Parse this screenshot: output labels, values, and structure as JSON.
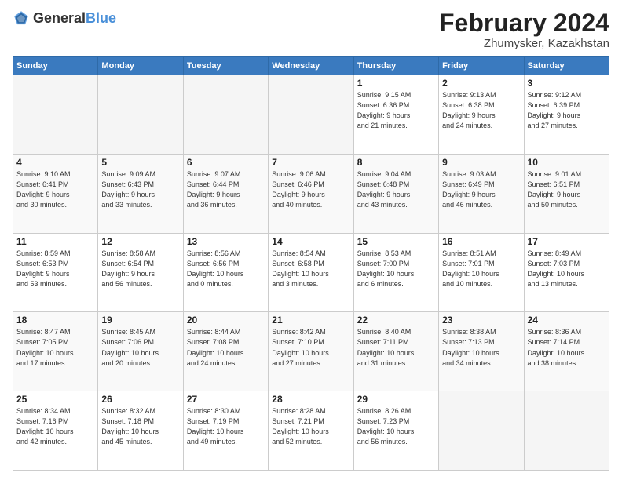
{
  "header": {
    "logo_general": "General",
    "logo_blue": "Blue",
    "title": "February 2024",
    "location": "Zhumysker, Kazakhstan"
  },
  "weekdays": [
    "Sunday",
    "Monday",
    "Tuesday",
    "Wednesday",
    "Thursday",
    "Friday",
    "Saturday"
  ],
  "weeks": [
    [
      {
        "day": "",
        "info": ""
      },
      {
        "day": "",
        "info": ""
      },
      {
        "day": "",
        "info": ""
      },
      {
        "day": "",
        "info": ""
      },
      {
        "day": "1",
        "info": "Sunrise: 9:15 AM\nSunset: 6:36 PM\nDaylight: 9 hours\nand 21 minutes."
      },
      {
        "day": "2",
        "info": "Sunrise: 9:13 AM\nSunset: 6:38 PM\nDaylight: 9 hours\nand 24 minutes."
      },
      {
        "day": "3",
        "info": "Sunrise: 9:12 AM\nSunset: 6:39 PM\nDaylight: 9 hours\nand 27 minutes."
      }
    ],
    [
      {
        "day": "4",
        "info": "Sunrise: 9:10 AM\nSunset: 6:41 PM\nDaylight: 9 hours\nand 30 minutes."
      },
      {
        "day": "5",
        "info": "Sunrise: 9:09 AM\nSunset: 6:43 PM\nDaylight: 9 hours\nand 33 minutes."
      },
      {
        "day": "6",
        "info": "Sunrise: 9:07 AM\nSunset: 6:44 PM\nDaylight: 9 hours\nand 36 minutes."
      },
      {
        "day": "7",
        "info": "Sunrise: 9:06 AM\nSunset: 6:46 PM\nDaylight: 9 hours\nand 40 minutes."
      },
      {
        "day": "8",
        "info": "Sunrise: 9:04 AM\nSunset: 6:48 PM\nDaylight: 9 hours\nand 43 minutes."
      },
      {
        "day": "9",
        "info": "Sunrise: 9:03 AM\nSunset: 6:49 PM\nDaylight: 9 hours\nand 46 minutes."
      },
      {
        "day": "10",
        "info": "Sunrise: 9:01 AM\nSunset: 6:51 PM\nDaylight: 9 hours\nand 50 minutes."
      }
    ],
    [
      {
        "day": "11",
        "info": "Sunrise: 8:59 AM\nSunset: 6:53 PM\nDaylight: 9 hours\nand 53 minutes."
      },
      {
        "day": "12",
        "info": "Sunrise: 8:58 AM\nSunset: 6:54 PM\nDaylight: 9 hours\nand 56 minutes."
      },
      {
        "day": "13",
        "info": "Sunrise: 8:56 AM\nSunset: 6:56 PM\nDaylight: 10 hours\nand 0 minutes."
      },
      {
        "day": "14",
        "info": "Sunrise: 8:54 AM\nSunset: 6:58 PM\nDaylight: 10 hours\nand 3 minutes."
      },
      {
        "day": "15",
        "info": "Sunrise: 8:53 AM\nSunset: 7:00 PM\nDaylight: 10 hours\nand 6 minutes."
      },
      {
        "day": "16",
        "info": "Sunrise: 8:51 AM\nSunset: 7:01 PM\nDaylight: 10 hours\nand 10 minutes."
      },
      {
        "day": "17",
        "info": "Sunrise: 8:49 AM\nSunset: 7:03 PM\nDaylight: 10 hours\nand 13 minutes."
      }
    ],
    [
      {
        "day": "18",
        "info": "Sunrise: 8:47 AM\nSunset: 7:05 PM\nDaylight: 10 hours\nand 17 minutes."
      },
      {
        "day": "19",
        "info": "Sunrise: 8:45 AM\nSunset: 7:06 PM\nDaylight: 10 hours\nand 20 minutes."
      },
      {
        "day": "20",
        "info": "Sunrise: 8:44 AM\nSunset: 7:08 PM\nDaylight: 10 hours\nand 24 minutes."
      },
      {
        "day": "21",
        "info": "Sunrise: 8:42 AM\nSunset: 7:10 PM\nDaylight: 10 hours\nand 27 minutes."
      },
      {
        "day": "22",
        "info": "Sunrise: 8:40 AM\nSunset: 7:11 PM\nDaylight: 10 hours\nand 31 minutes."
      },
      {
        "day": "23",
        "info": "Sunrise: 8:38 AM\nSunset: 7:13 PM\nDaylight: 10 hours\nand 34 minutes."
      },
      {
        "day": "24",
        "info": "Sunrise: 8:36 AM\nSunset: 7:14 PM\nDaylight: 10 hours\nand 38 minutes."
      }
    ],
    [
      {
        "day": "25",
        "info": "Sunrise: 8:34 AM\nSunset: 7:16 PM\nDaylight: 10 hours\nand 42 minutes."
      },
      {
        "day": "26",
        "info": "Sunrise: 8:32 AM\nSunset: 7:18 PM\nDaylight: 10 hours\nand 45 minutes."
      },
      {
        "day": "27",
        "info": "Sunrise: 8:30 AM\nSunset: 7:19 PM\nDaylight: 10 hours\nand 49 minutes."
      },
      {
        "day": "28",
        "info": "Sunrise: 8:28 AM\nSunset: 7:21 PM\nDaylight: 10 hours\nand 52 minutes."
      },
      {
        "day": "29",
        "info": "Sunrise: 8:26 AM\nSunset: 7:23 PM\nDaylight: 10 hours\nand 56 minutes."
      },
      {
        "day": "",
        "info": ""
      },
      {
        "day": "",
        "info": ""
      }
    ]
  ]
}
